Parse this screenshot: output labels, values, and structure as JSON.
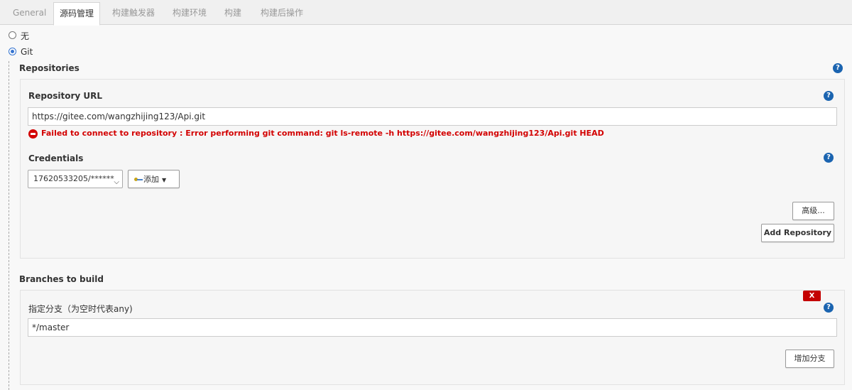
{
  "tabs": [
    {
      "label": "General",
      "active": false
    },
    {
      "label": "源码管理",
      "active": true
    },
    {
      "label": "构建触发器",
      "active": false
    },
    {
      "label": "构建环境",
      "active": false
    },
    {
      "label": "构建",
      "active": false
    },
    {
      "label": "构建后操作",
      "active": false
    }
  ],
  "scm": {
    "option_none": "无",
    "option_git": "Git",
    "selected": "Git"
  },
  "repositories": {
    "section_label": "Repositories",
    "url_label": "Repository URL",
    "url_value": "https://gitee.com/wangzhijing123/Api.git",
    "error_message": "Failed to connect to repository : Error performing git command: git ls-remote -h https://gitee.com/wangzhijing123/Api.git HEAD",
    "credentials_label": "Credentials",
    "credentials_value": "17620533205/******",
    "add_button": "添加",
    "advanced_button": "高级...",
    "add_repository_button": "Add Repository"
  },
  "branches": {
    "section_label": "Branches to build",
    "delete_button": "X",
    "branch_spec_label": "指定分支（为空时代表any)",
    "branch_spec_value": "*/master",
    "add_branch_button": "增加分支"
  },
  "help_symbol": "?",
  "colors": {
    "error": "#d30000",
    "help_icon": "#1b64b0",
    "delete_button": "#c40000"
  }
}
